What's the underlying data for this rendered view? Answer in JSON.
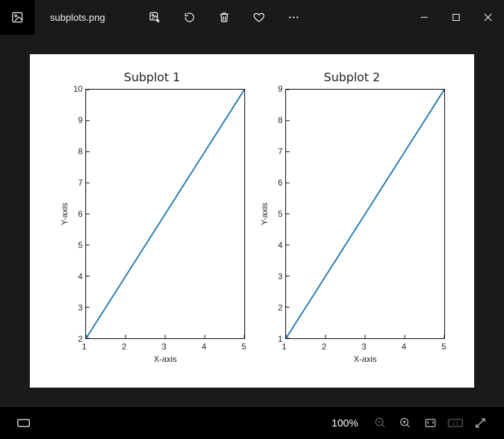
{
  "titlebar": {
    "filename": "subplots.png"
  },
  "bottombar": {
    "zoom_label": "100%"
  },
  "chart_data": [
    {
      "type": "line",
      "title": "Subplot 1",
      "xlabel": "X-axis",
      "ylabel": "Y-axis",
      "x": [
        1,
        2,
        3,
        4,
        5
      ],
      "y": [
        2,
        4,
        6,
        8,
        10
      ],
      "xlim": [
        1,
        5
      ],
      "ylim": [
        2,
        10
      ],
      "xticks": [
        1,
        2,
        3,
        4,
        5
      ],
      "yticks": [
        2,
        3,
        4,
        5,
        6,
        7,
        8,
        9,
        10
      ],
      "line_color": "#1f77b4"
    },
    {
      "type": "line",
      "title": "Subplot 2",
      "xlabel": "X-axis",
      "ylabel": "Y-axis",
      "x": [
        1,
        2,
        3,
        4,
        5
      ],
      "y": [
        1,
        3,
        5,
        7,
        9
      ],
      "xlim": [
        1,
        5
      ],
      "ylim": [
        1,
        9
      ],
      "xticks": [
        1,
        2,
        3,
        4,
        5
      ],
      "yticks": [
        1,
        2,
        3,
        4,
        5,
        6,
        7,
        8,
        9
      ],
      "line_color": "#1f77b4"
    }
  ]
}
